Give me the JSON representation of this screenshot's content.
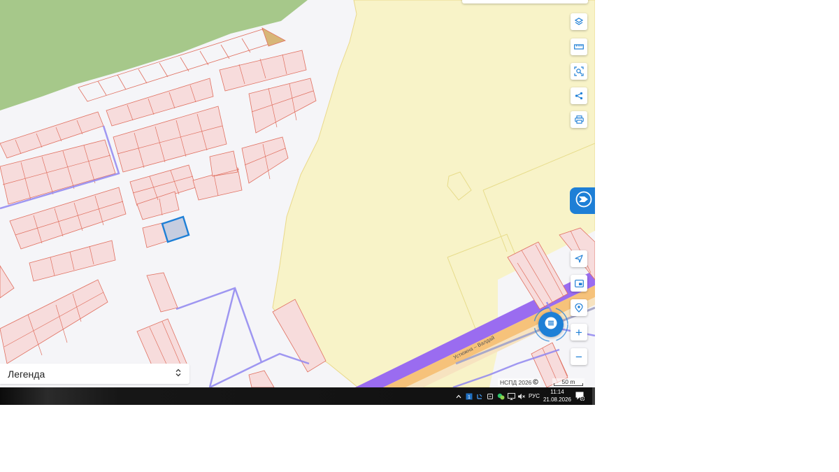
{
  "map": {
    "attribution": "НСПД 2026",
    "attribution_icon": "copyright-icon",
    "scale_label": "50 m",
    "road_label": "Устюжна – Валдай"
  },
  "toolbar": {
    "top_tools": [
      {
        "name": "layers-icon"
      },
      {
        "name": "ruler-icon"
      },
      {
        "name": "area-select-icon"
      },
      {
        "name": "share-icon"
      },
      {
        "name": "print-icon"
      }
    ],
    "bottom_tools": [
      {
        "name": "locate-arrow-icon"
      },
      {
        "name": "minimap-icon"
      },
      {
        "name": "geolocation-pin-icon"
      },
      {
        "name": "zoom-in-icon",
        "label": "+"
      },
      {
        "name": "zoom-out-icon",
        "label": "−"
      }
    ]
  },
  "legend": {
    "label": "Легенда",
    "chevron_icon": "chevron-up-down-icon"
  },
  "colors": {
    "accent": "#1e7fd6",
    "forest": "#a6c88a",
    "zone_yellow": "#f8f3c8",
    "parcel_fill": "#f7dcdc",
    "parcel_stroke": "#e07060",
    "boundary_purple": "#8f86f0",
    "road_purple": "#9a6cf0",
    "road_orange": "#f6c27a"
  },
  "taskbar": {
    "language": "РУС",
    "time": "11:14",
    "date": "21.08.2026",
    "notification_count": "1",
    "tray_icons": [
      "chevron-up-icon",
      "app-tray-icon",
      "pen-icon",
      "vpn-icon",
      "chat-tray-icon",
      "monitor-icon",
      "volume-muted-icon"
    ]
  }
}
